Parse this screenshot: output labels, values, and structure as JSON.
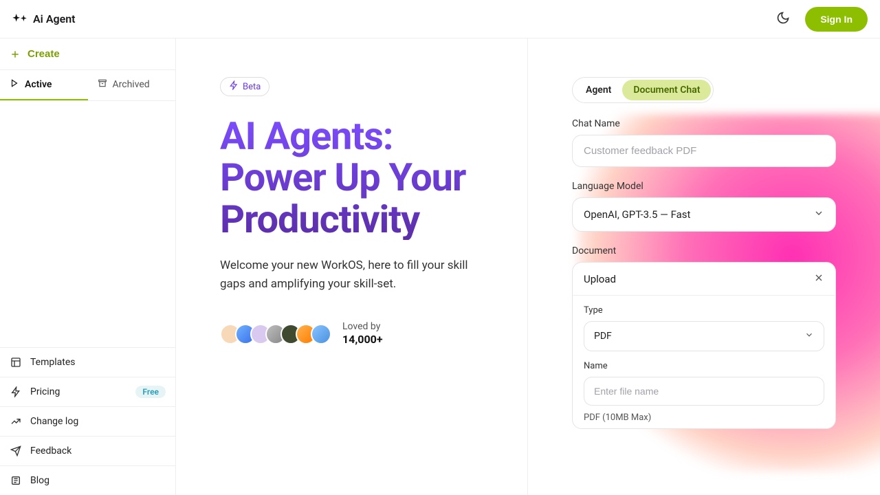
{
  "brand": {
    "name": "Ai Agent"
  },
  "topbar": {
    "signin": "Sign In"
  },
  "sidebar": {
    "create": "Create",
    "tabs": {
      "active": "Active",
      "archived": "Archived"
    },
    "items": [
      {
        "label": "Templates",
        "badge": null
      },
      {
        "label": "Pricing",
        "badge": "Free"
      },
      {
        "label": "Change log",
        "badge": null
      },
      {
        "label": "Feedback",
        "badge": null
      },
      {
        "label": "Blog",
        "badge": null
      }
    ]
  },
  "hero": {
    "badge": "Beta",
    "title": "AI Agents: Power Up Your Productivity",
    "subtitle": "Welcome your new WorkOS, here to fill your skill gaps and amplifying your skill-set.",
    "loved_label": "Loved by",
    "loved_count": "14,000+"
  },
  "form": {
    "mode_tabs": {
      "agent": "Agent",
      "document_chat": "Document Chat"
    },
    "chat_name_label": "Chat Name",
    "chat_name_placeholder": "Customer feedback PDF",
    "model_label": "Language Model",
    "model_value": "OpenAI, GPT-3.5 — Fast",
    "document_label": "Document",
    "upload": {
      "title": "Upload",
      "type_label": "Type",
      "type_value": "PDF",
      "name_label": "Name",
      "name_placeholder": "Enter file name",
      "file_note": "PDF (10MB Max)"
    }
  }
}
